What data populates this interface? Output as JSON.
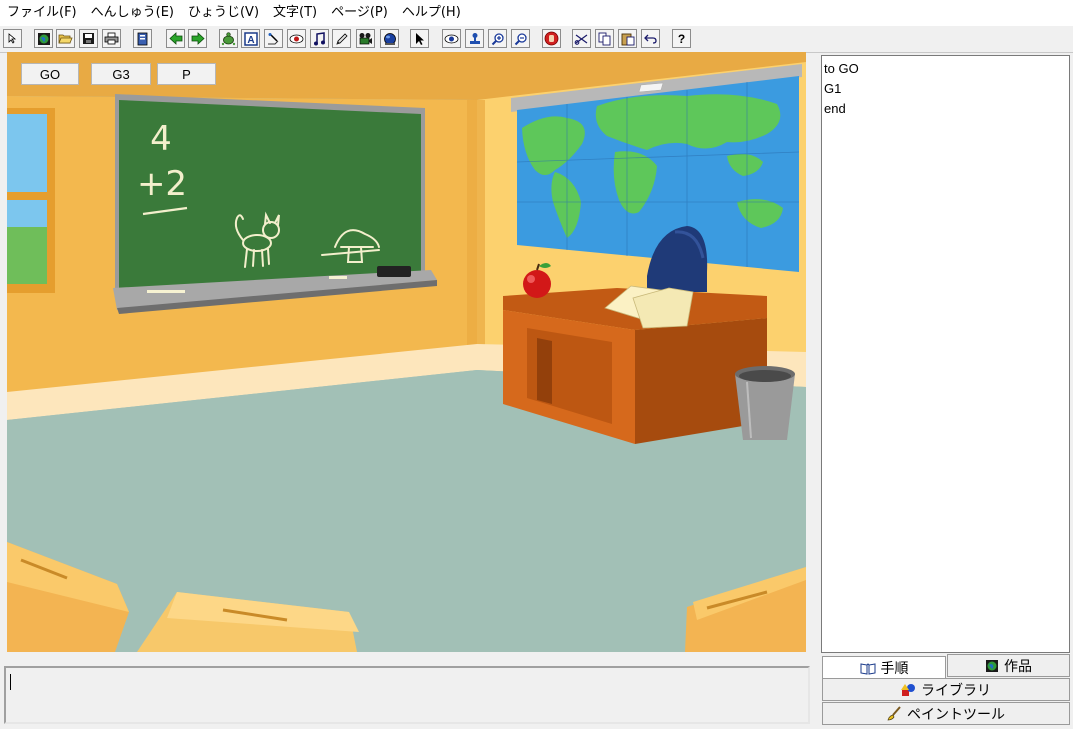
{
  "menu": [
    "ファイル(F)",
    "へんしゅう(E)",
    "ひょうじ(V)",
    "文字(T)",
    "ページ(P)",
    "ヘルプ(H)"
  ],
  "toolbar_icons": [
    "select-tool-icon",
    "globe-icon",
    "open-folder-icon",
    "save-disk-icon",
    "print-icon",
    "book-icon",
    "arrow-left-icon",
    "arrow-right-icon",
    "turtle-icon",
    "text-box-icon",
    "magnet-icon",
    "eye-red-icon",
    "music-note-icon",
    "pencil-icon",
    "film-camera-icon",
    "sphere-icon",
    "cursor-arrow-icon",
    "eye-icon",
    "stamp-icon",
    "zoom-in-icon",
    "zoom-out-icon",
    "stop-hand-icon",
    "scissors-icon",
    "copy-icon",
    "paste-icon",
    "undo-icon",
    "help-icon"
  ],
  "stage": {
    "buttons": [
      "GO",
      "G3",
      "P"
    ],
    "chalkboard": {
      "line1": "4",
      "line2": "+2"
    }
  },
  "editor": {
    "lines": [
      "to GO",
      "G1",
      "end"
    ]
  },
  "tabs": {
    "procedures": "手順",
    "project": "作品",
    "library": "ライブラリ",
    "paint_tools": "ペイントツール"
  },
  "message": {
    "text": ""
  }
}
